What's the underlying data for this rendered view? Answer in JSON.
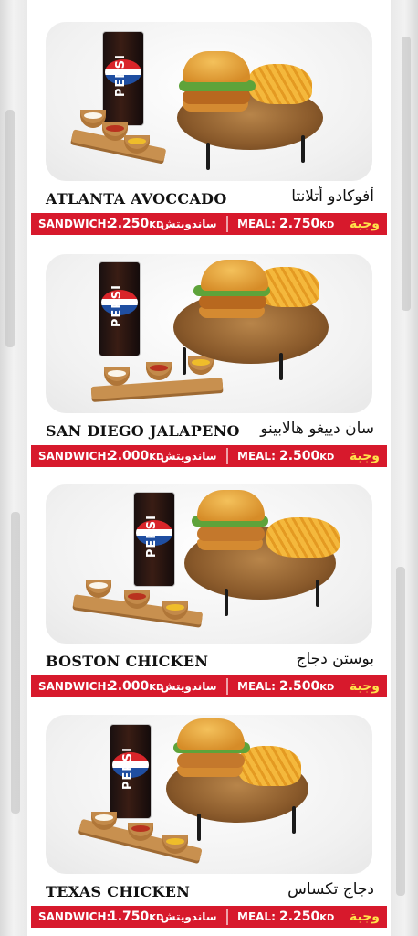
{
  "items": [
    {
      "name_en": "ATLANTA AVOCCADO",
      "name_ar": "أفوكادو أتلانتا",
      "sandwich_label": "SANDWICH:",
      "sandwich_price": "2.250",
      "currency": "KD",
      "sandwich_ar": "ساندويتش",
      "meal_label": "MEAL:",
      "meal_price": "2.750",
      "meal_ar": "وجبة",
      "cup_brand": "PEPSI"
    },
    {
      "name_en": "SAN DIEGO JALAPENO",
      "name_ar": "سان دييغو هالابينو",
      "sandwich_label": "SANDWICH:",
      "sandwich_price": "2.000",
      "currency": "KD",
      "sandwich_ar": "ساندويتش",
      "meal_label": "MEAL:",
      "meal_price": "2.500",
      "meal_ar": "وجبة",
      "cup_brand": "PEPSI"
    },
    {
      "name_en": "BOSTON CHICKEN",
      "name_ar": "بوستن دجاج",
      "sandwich_label": "SANDWICH:",
      "sandwich_price": "2.000",
      "currency": "KD",
      "sandwich_ar": "ساندويتش",
      "meal_label": "MEAL:",
      "meal_price": "2.500",
      "meal_ar": "وجبة",
      "cup_brand": "PEPSI"
    },
    {
      "name_en": "TEXAS CHICKEN",
      "name_ar": "دجاج تكساس",
      "sandwich_label": "SANDWICH:",
      "sandwich_price": "1.750",
      "currency": "KD",
      "sandwich_ar": "ساندويتش",
      "meal_label": "MEAL:",
      "meal_price": "2.250",
      "meal_ar": "وجبة",
      "cup_brand": "PEPSI"
    }
  ],
  "colors": {
    "price_bar": "#d7192c",
    "meal_arabic": "#ffe24a"
  }
}
